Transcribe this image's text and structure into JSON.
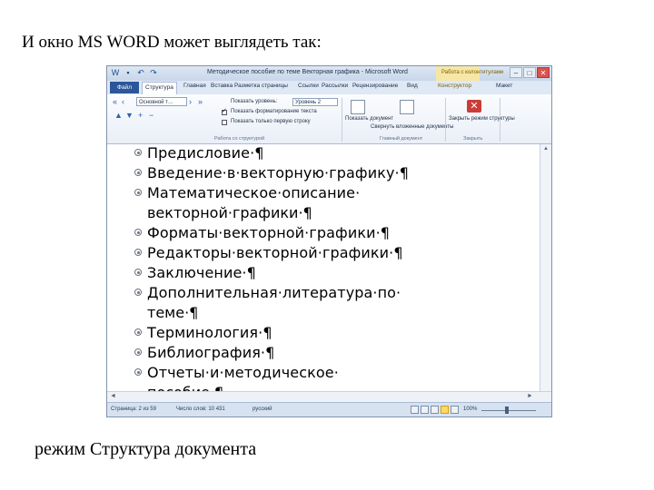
{
  "caption": "И окно MS WORD может выглядеть так:",
  "footer": "режим Структура документа",
  "window": {
    "title": "Методическое пособие по теме Векторная графика - Microsoft Word",
    "context_tab_label": "Работа с колонтитулами",
    "controls": [
      "–",
      "□",
      "✕"
    ],
    "quick_access_icons": [
      "word-icon",
      "save-icon",
      "undo-icon",
      "redo-icon"
    ]
  },
  "tabs": [
    "Файл",
    "Структура",
    "Главная",
    "Вставка",
    "Разметка страницы",
    "Ссылки",
    "Рассылки",
    "Рецензирование",
    "Вид",
    "Конструктор",
    "Макет"
  ],
  "ribbon": {
    "level_value": "Основной т…",
    "show_level_label": "Показать уровень:",
    "show_level_value": "Уровень 2",
    "check_format": "Показать форматирование текста",
    "check_first_line": "Показать только первую строку",
    "group_tools": "Работа со структурой",
    "show_document": "Показать документ",
    "collapse_subdocs": "Свернуть вложенные документы",
    "group_master": "Главный документ",
    "close_outline": "Закрыть режим структуры",
    "group_close": "Закрыть"
  },
  "outline": {
    "items": [
      "Предисловие·¶",
      "Введение·в·векторную·графику·¶",
      "Математическое·описание·",
      "Форматы·векторной·графики·¶",
      "Редакторы·векторной·графики·¶",
      "Заключение·¶",
      "Дополнительная·литература·по·",
      "Терминология·¶",
      "Библиография·¶",
      "Отчеты·и·методическое·"
    ],
    "continuations": [
      "векторной·графики·¶",
      "теме·¶",
      "пособие·¶"
    ]
  },
  "status": {
    "page": "Страница: 2 из 59",
    "words": "Число слов: 10 431",
    "language": "русский",
    "zoom": "100%"
  }
}
